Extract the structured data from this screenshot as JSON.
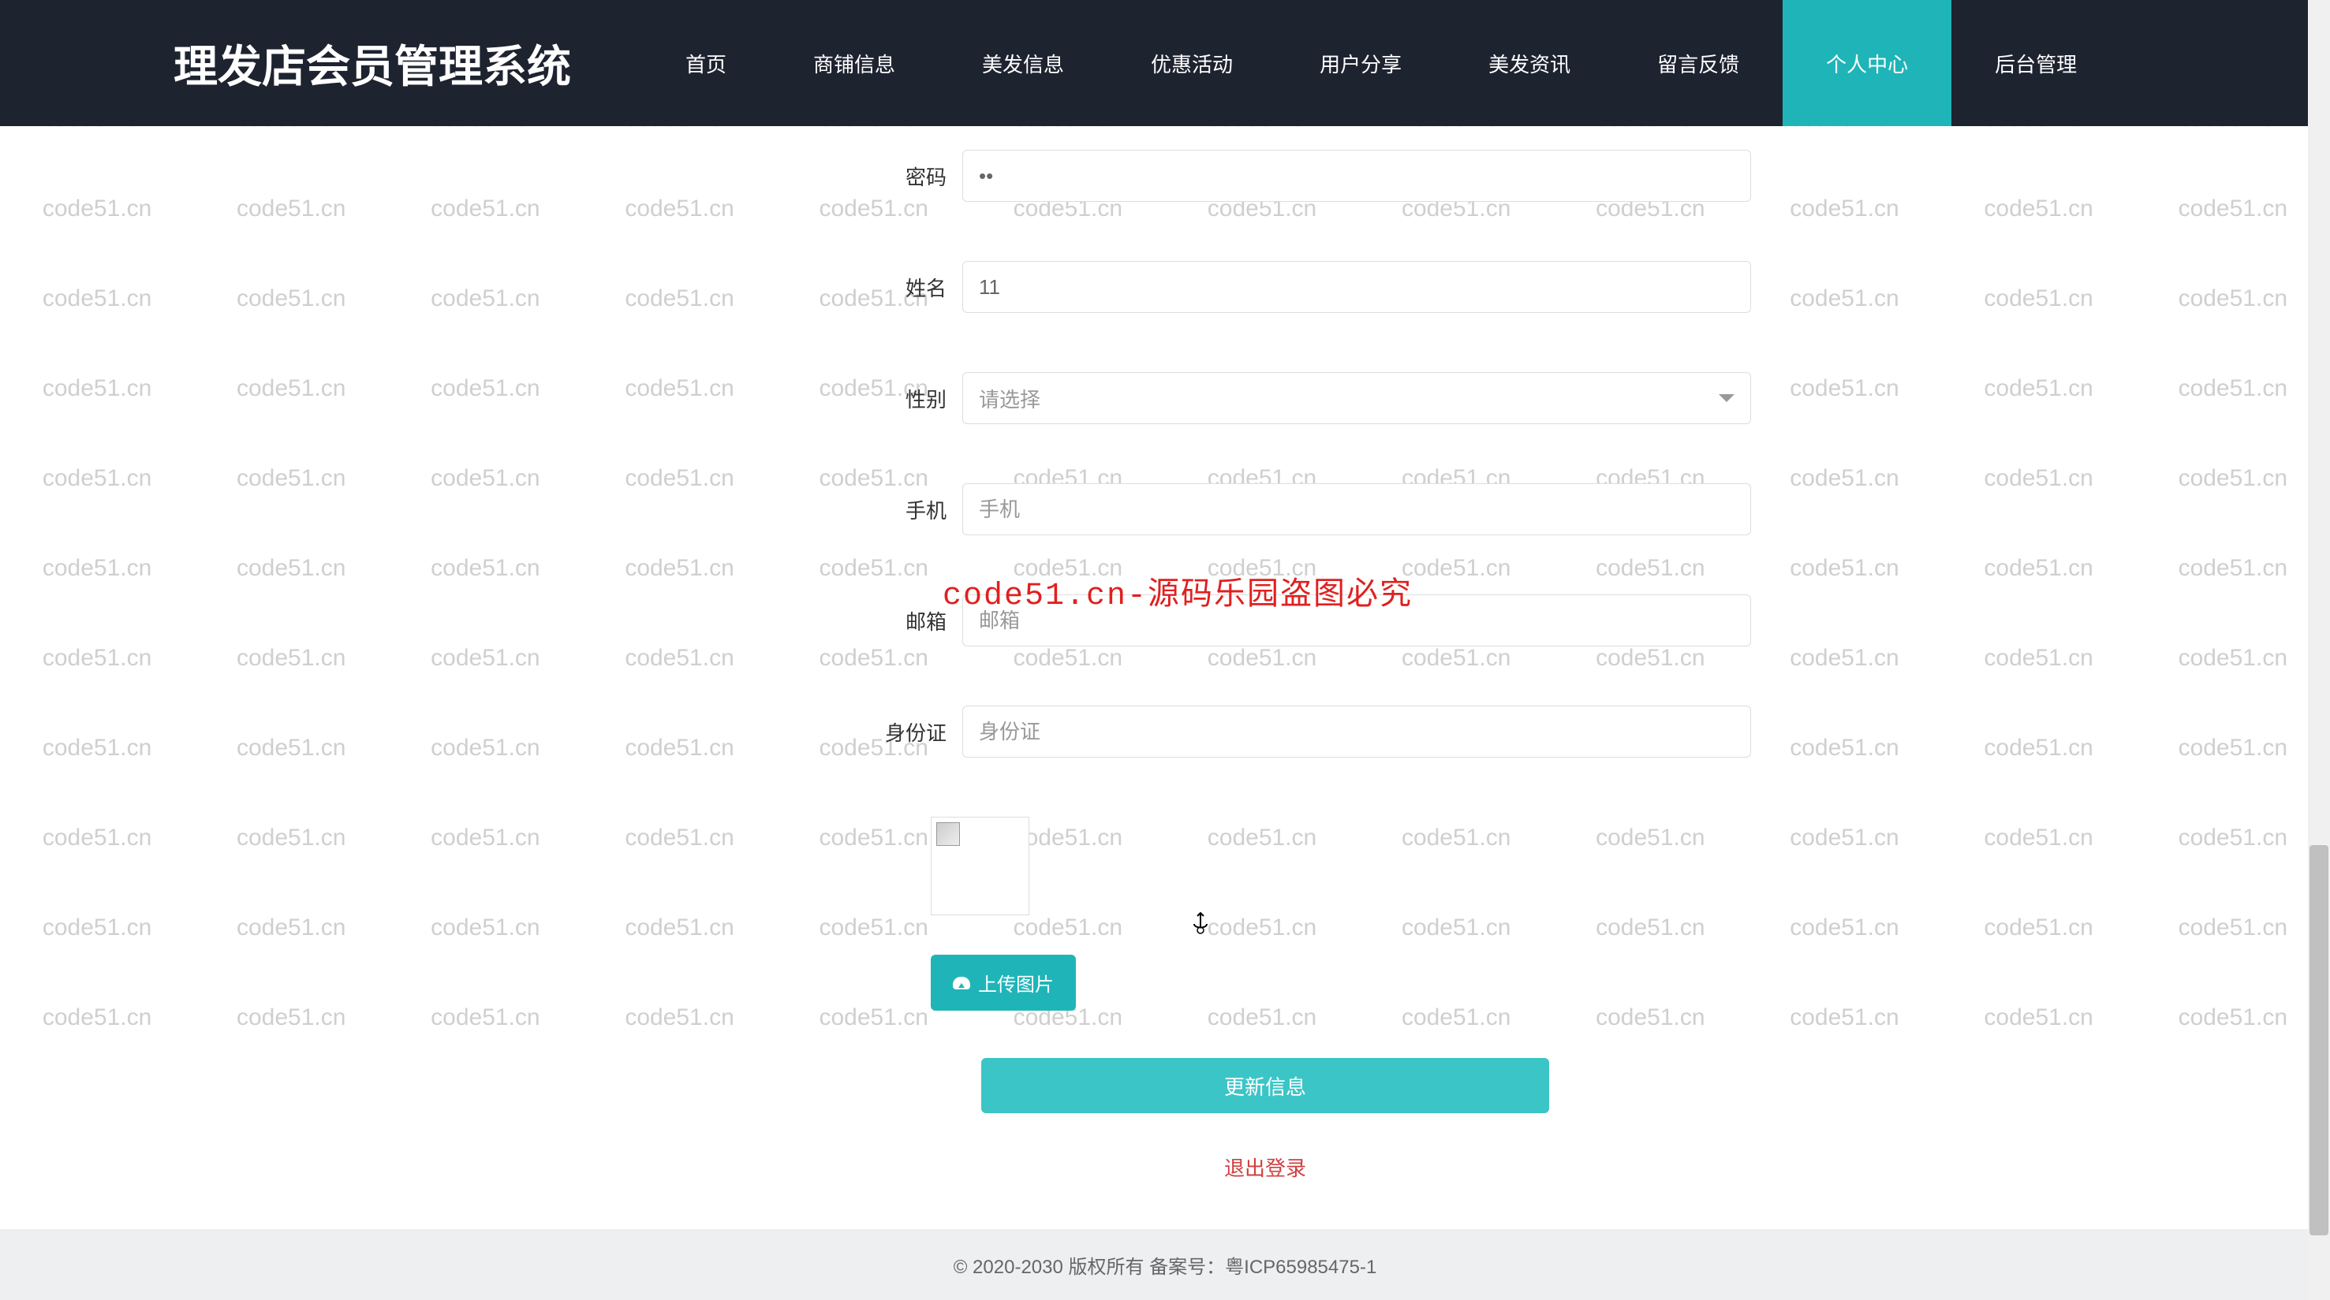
{
  "header": {
    "logo": "理发店会员管理系统",
    "nav": [
      {
        "label": "首页",
        "active": false
      },
      {
        "label": "商铺信息",
        "active": false
      },
      {
        "label": "美发信息",
        "active": false
      },
      {
        "label": "优惠活动",
        "active": false
      },
      {
        "label": "用户分享",
        "active": false
      },
      {
        "label": "美发资讯",
        "active": false
      },
      {
        "label": "留言反馈",
        "active": false
      },
      {
        "label": "个人中心",
        "active": true
      },
      {
        "label": "后台管理",
        "active": false
      }
    ]
  },
  "form": {
    "password": {
      "label": "密码",
      "value": "••"
    },
    "name": {
      "label": "姓名",
      "value": "11"
    },
    "gender": {
      "label": "性别",
      "placeholder": "请选择"
    },
    "phone": {
      "label": "手机",
      "placeholder": "手机"
    },
    "email": {
      "label": "邮箱",
      "placeholder": "邮箱"
    },
    "idcard": {
      "label": "身份证",
      "placeholder": "身份证"
    },
    "upload_button": "上传图片",
    "submit_button": "更新信息",
    "logout_link": "退出登录"
  },
  "overlay_watermark": "code51.cn-源码乐园盗图必究",
  "footer": {
    "copyright": "© 2020-2030 版权所有 备案号：粤ICP65985475-1"
  },
  "watermark_text": "code51.cn"
}
